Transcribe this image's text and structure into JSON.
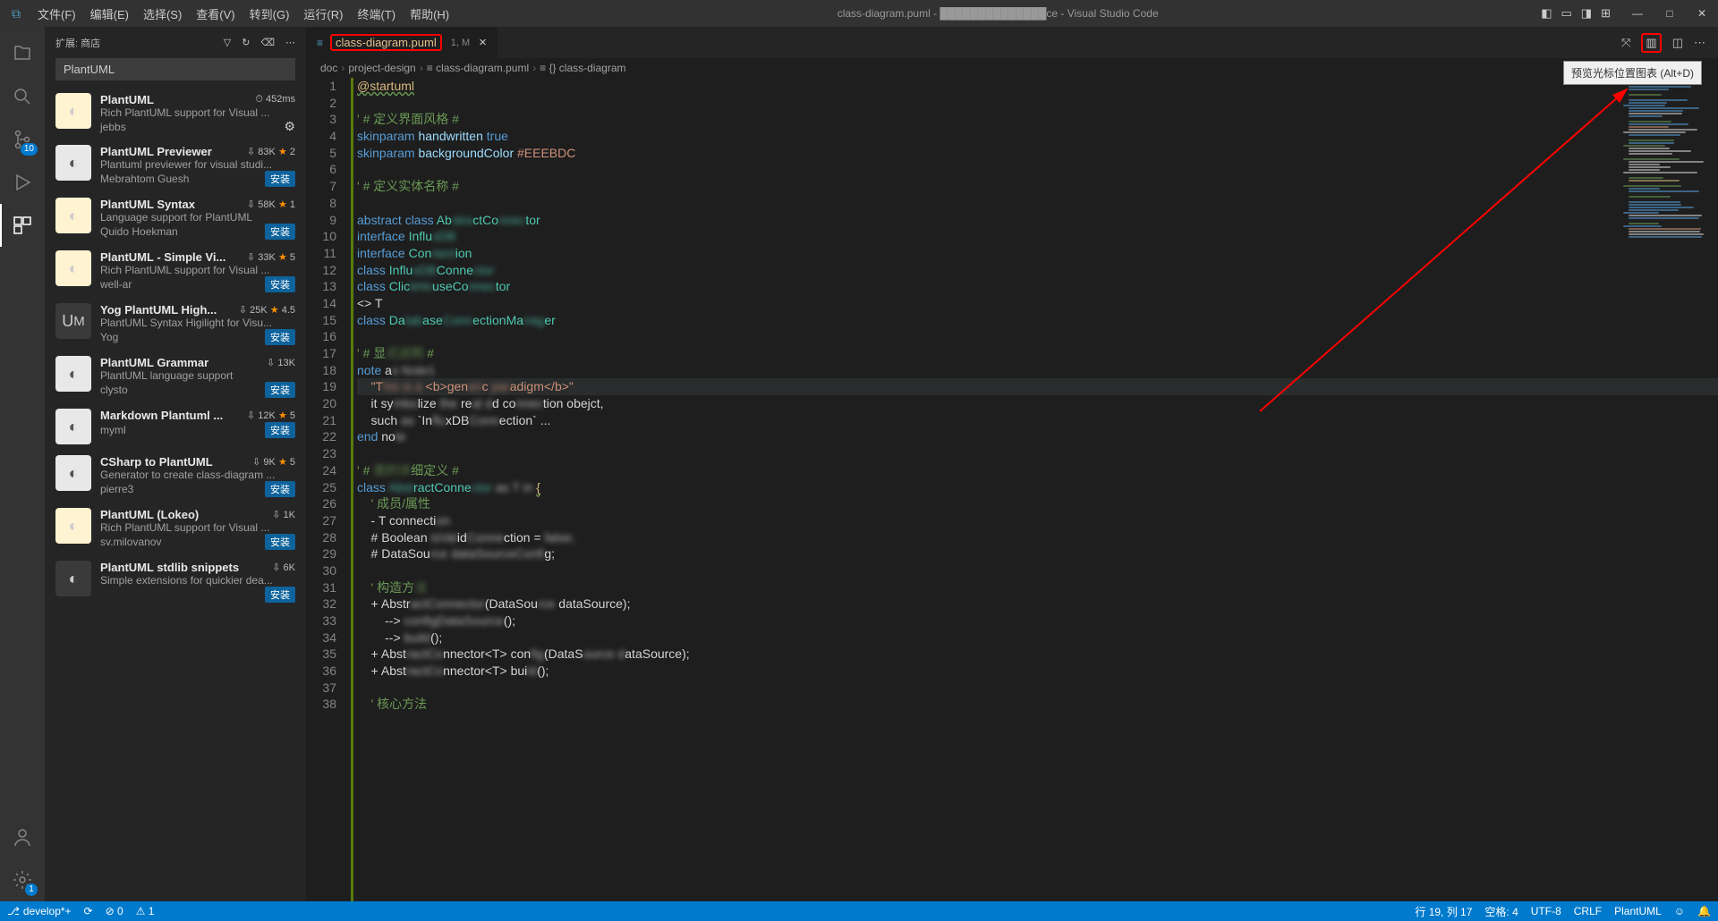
{
  "title": "class-diagram.puml - ██████████████ce - Visual Studio Code",
  "menu": [
    "文件(F)",
    "编辑(E)",
    "选择(S)",
    "查看(V)",
    "转到(G)",
    "运行(R)",
    "终端(T)",
    "帮助(H)"
  ],
  "activity_badges": {
    "scm": "10",
    "settings": "1"
  },
  "sidebar": {
    "header": "扩展: 商店",
    "search": "PlantUML"
  },
  "extensions": [
    {
      "name": "PlantUML",
      "stats": "⏱ 452ms",
      "desc": "Rich PlantUML support for Visual ...",
      "pub": "jebbs",
      "action": "gear",
      "ico": "puml"
    },
    {
      "name": "PlantUML Previewer",
      "stats": "⇩ 83K ★ 2",
      "desc": "Plantuml previewer for visual studi...",
      "pub": "Mebrahtom Guesh",
      "action": "install",
      "ico": "white"
    },
    {
      "name": "PlantUML Syntax",
      "stats": "⇩ 58K ★ 1",
      "desc": "Language support for PlantUML",
      "pub": "Quido Hoekman",
      "action": "install",
      "ico": "puml"
    },
    {
      "name": "PlantUML - Simple Vi...",
      "stats": "⇩ 33K ★ 5",
      "desc": "Rich PlantUML support for Visual ...",
      "pub": "well-ar",
      "action": "install",
      "ico": "puml"
    },
    {
      "name": "Yog PlantUML High...",
      "stats": "⇩ 25K ★ 4.5",
      "desc": "PlantUML Syntax Higilight for Visu...",
      "pub": "Yog",
      "action": "install",
      "ico": "yog"
    },
    {
      "name": "PlantUML Grammar",
      "stats": "⇩ 13K",
      "desc": "PlantUML language support",
      "pub": "clysto",
      "action": "install",
      "ico": "white"
    },
    {
      "name": "Markdown Plantuml ...",
      "stats": "⇩ 12K ★ 5",
      "desc": "",
      "pub": "myml",
      "action": "install",
      "ico": "white"
    },
    {
      "name": "CSharp to PlantUML",
      "stats": "⇩ 9K ★ 5",
      "desc": "Generator to create class-diagram ...",
      "pub": "pierre3",
      "action": "install",
      "ico": "white"
    },
    {
      "name": "PlantUML (Lokeo)",
      "stats": "⇩ 1K",
      "desc": "Rich PlantUML support for Visual ...",
      "pub": "sv.milovanov",
      "action": "install",
      "ico": "puml"
    },
    {
      "name": "PlantUML stdlib snippets",
      "stats": "⇩ 6K",
      "desc": "Simple extensions for quickier dea...",
      "pub": "",
      "action": "install",
      "ico": "dark"
    }
  ],
  "install_label": "安装",
  "tab": {
    "name": "class-diagram.puml",
    "dirty": "1, M"
  },
  "breadcrumb": [
    "doc",
    "project-design",
    "class-diagram.puml",
    "class-diagram"
  ],
  "tooltip": "预览光标位置图表 (Alt+D)",
  "code": [
    {
      "n": 1,
      "h": "<span class='c-ann'>@startuml</span>"
    },
    {
      "n": 2,
      "h": ""
    },
    {
      "n": 3,
      "h": "<span class='c-com'>' # 定义界面风格 #</span>"
    },
    {
      "n": 4,
      "h": "<span class='c-kw'>skinparam</span> <span class='c-cls2'>handwritten</span> <span class='c-kw'>true</span>"
    },
    {
      "n": 5,
      "h": "<span class='c-kw'>skinparam</span> <span class='c-cls2'>backgroundColor</span> <span class='c-num'>#EEEBDC</span>"
    },
    {
      "n": 6,
      "h": ""
    },
    {
      "n": 7,
      "h": "<span class='c-com'>' # 定义实体名称 #</span>"
    },
    {
      "n": 8,
      "h": ""
    },
    {
      "n": 9,
      "h": "<span class='c-kw'>abstract class</span> <span class='c-cls'>Ab<span class='blur'>stra</span>ctCo<span class='blur'>nnec</span>tor</span>"
    },
    {
      "n": 10,
      "h": "<span class='c-kw'>interface</span> <span class='c-cls'>Influ<span class='blur'>xDB</span></span>"
    },
    {
      "n": 11,
      "h": "<span class='c-kw'>interface</span> <span class='c-cls'>Con<span class='blur'>nect</span>ion</span>"
    },
    {
      "n": 12,
      "h": "<span class='c-kw'>class</span> <span class='c-cls'>Influ<span class='blur'>xDB</span>Conne<span class='blur'>ctor</span></span>"
    },
    {
      "n": 13,
      "h": "<span class='c-kw'>class</span> <span class='c-cls'>Clic<span class='blur'>kHo</span>useCo<span class='blur'>nnec</span>tor</span>"
    },
    {
      "n": 14,
      "h": "&lt;&gt; T"
    },
    {
      "n": 15,
      "h": "<span class='c-kw'>class</span> <span class='c-cls'>Da<span class='blur'>tab</span>ase<span class='blur'>Conn</span>ectionMa<span class='blur'>nag</span>er</span>"
    },
    {
      "n": 16,
      "h": ""
    },
    {
      "n": 17,
      "h": "<span class='c-com'>' # 显<span class='blur'>式说明</span> #</span>"
    },
    {
      "n": 18,
      "h": "<span class='c-kw'>note</span> a<span class='blur'>s N</span><span class='blur'>ote1</span>"
    },
    {
      "n": 19,
      "h": "    <span class='c-str'>\"T<span class='blur'>his is a</span> &lt;b&gt;gen<span class='blur'>eri</span>c <span class='blur'>par</span>adigm&lt;/b&gt;\"</span>",
      "cur": true
    },
    {
      "n": 20,
      "h": "    it sy<span class='blur'>mbo</span>lize <span class='blur'>the</span> re<span class='blur'>al</span> <span class='blur'>d</span>d co<span class='blur'>nnec</span>tion obejct,"
    },
    {
      "n": 21,
      "h": "    such <span class='blur'>as</span> `In<span class='blur'>flu</span>xDB<span class='blur'>Conn</span>ection` ..."
    },
    {
      "n": 22,
      "h": "<span class='c-kw'>end</span> no<span class='blur'>te</span>"
    },
    {
      "n": 23,
      "h": ""
    },
    {
      "n": 24,
      "h": "<span class='c-com'>' # <span class='blur'>类的详</span>细定义 #</span>"
    },
    {
      "n": 25,
      "h": "<span class='c-kw'>class</span> <span class='c-cls'><span class='blur'>Abst</span>ractConne<span class='blur'>ctor</span></span> <span class='blur'>as T</span> <span class='blur'>in</span> <span class='c-ann'>{</span>"
    },
    {
      "n": 26,
      "h": "    <span class='c-com'>' 成员/属性</span>"
    },
    {
      "n": 27,
      "h": "    - T connecti<span class='blur'>on</span>"
    },
    {
      "n": 28,
      "h": "    # Boolean <span class='blur'>isVal</span>id<span class='blur'>Conne</span>ction = <span class='blur'>false;</span>"
    },
    {
      "n": 29,
      "h": "    # DataSou<span class='blur'>rce</span> <span class='blur'>dataSourceConfi</span>g;"
    },
    {
      "n": 30,
      "h": ""
    },
    {
      "n": 31,
      "h": "    <span class='c-com'>' 构造方<span class='blur'>法</span></span>"
    },
    {
      "n": 32,
      "h": "    + Abstr<span class='blur'>actConnector</span>(DataSou<span class='blur'>rce</span> dataSource);"
    },
    {
      "n": 33,
      "h": "        --&gt; <span class='blur'>configDataSource</span>();"
    },
    {
      "n": 34,
      "h": "        --&gt; <span class='blur'>build</span>();"
    },
    {
      "n": 35,
      "h": "    + Abst<span class='blur'>ractCo</span>nnector&lt;T&gt; con<span class='blur'>fig</span>(DataS<span class='blur'>ource</span> <span class='blur'>d</span>ataSource);"
    },
    {
      "n": 36,
      "h": "    + Abst<span class='blur'>ractCo</span>nnector&lt;T&gt; bui<span class='blur'>ld</span>();"
    },
    {
      "n": 37,
      "h": ""
    },
    {
      "n": 38,
      "h": "    <span class='c-com'>' 核心方法</span>"
    }
  ],
  "status": {
    "branch": "develop*+",
    "sync": "⟳",
    "errors": "⊘ 0",
    "warnings": "⚠ 1",
    "pos": "行 19, 列 17",
    "spaces": "空格: 4",
    "enc": "UTF-8",
    "eol": "CRLF",
    "lang": "PlantUML",
    "feedback": "☺",
    "bell": "🔔"
  }
}
